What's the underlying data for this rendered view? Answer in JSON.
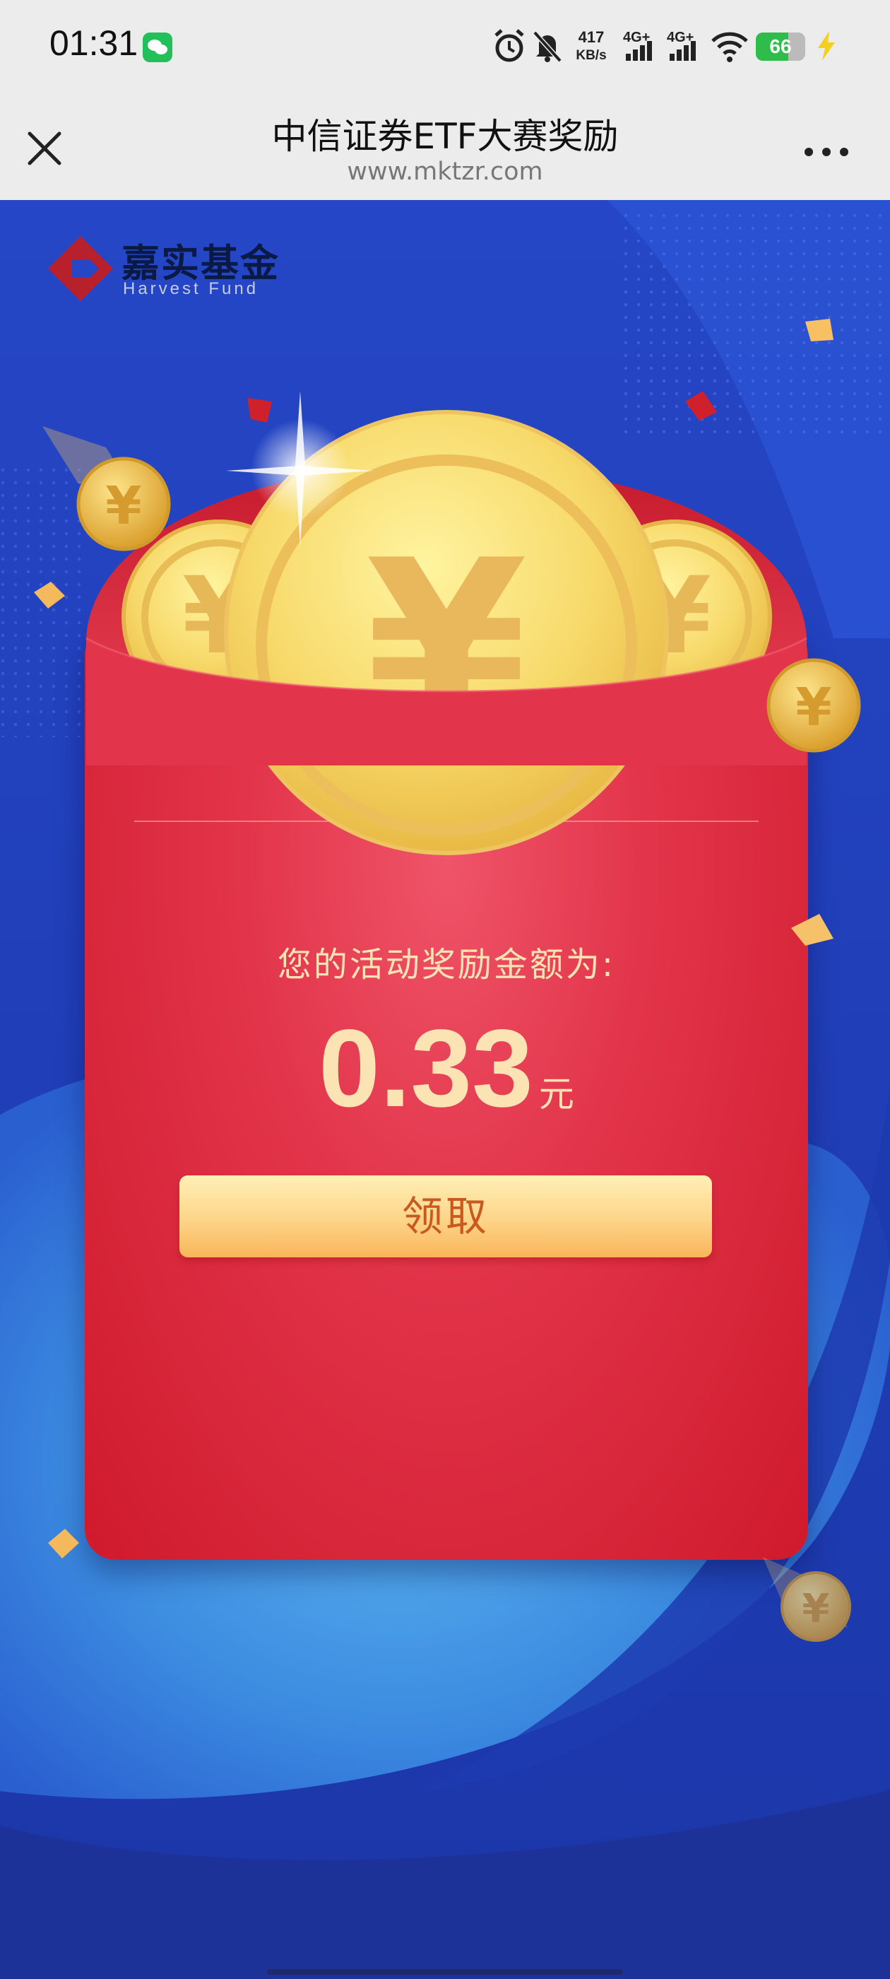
{
  "status_bar": {
    "time": "01:31",
    "app_badge_icon": "wechat-icon",
    "net_speed_value": "417",
    "net_speed_unit": "KB/s",
    "signal_1_label": "4G+",
    "signal_2_label": "4G+",
    "battery_level": "66",
    "battery_percent": 66,
    "icons": [
      "alarm-icon",
      "mute-bell-icon",
      "signal-icon",
      "wifi-icon",
      "charging-bolt-icon"
    ]
  },
  "title_bar": {
    "title": "中信证券ETF大赛奖励",
    "url": "www.mktzr.com",
    "close_icon": "close-icon",
    "more_icon": "more-dots-icon"
  },
  "brand": {
    "name_cn": "嘉实基金",
    "name_en": "Harvest Fund"
  },
  "reward": {
    "label": "您的活动奖励金额为:",
    "amount": "0.33",
    "unit": "元",
    "claim_button": "领取",
    "coin_symbol": "¥"
  },
  "colors": {
    "background_blue": "#1f3fb8",
    "envelope_red": "#e2344a",
    "button_gold": "#fdd489",
    "text_gold": "#fce3b4"
  }
}
